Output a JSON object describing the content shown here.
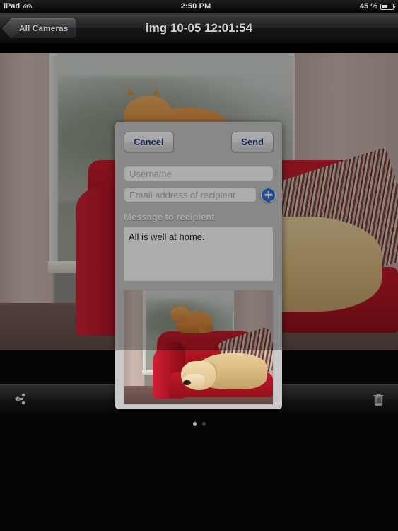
{
  "status_bar": {
    "device_label": "iPad",
    "wifi_icon": "wifi-icon",
    "time": "2:50 PM",
    "battery_percent": "45 %",
    "battery_icon": "battery-icon"
  },
  "nav_bar": {
    "back_button_label": "All Cameras",
    "title": "img 10-05 12:01:54"
  },
  "share_modal": {
    "cancel_label": "Cancel",
    "send_label": "Send",
    "username_placeholder": "Username",
    "username_value": "",
    "email_placeholder": "Email address of recipient",
    "email_value": "",
    "add_recipient_icon": "plus-circle-icon",
    "message_label": "Message to recipient",
    "message_value": "All is well at home.",
    "message_placeholder": "",
    "attachment_alt": "photo-thumbnail-cat-and-dog-on-red-sofa"
  },
  "bottom_toolbar": {
    "share_icon": "share-icon",
    "trash_icon": "trash-icon"
  },
  "page_indicator": {
    "total": 2,
    "active_index": 0
  },
  "colors": {
    "accent_blue": "#2a72d4",
    "button_text": "#1f3a7a",
    "modal_background": "#c9c9c9",
    "chrome_dark": "#1b1b1d"
  }
}
